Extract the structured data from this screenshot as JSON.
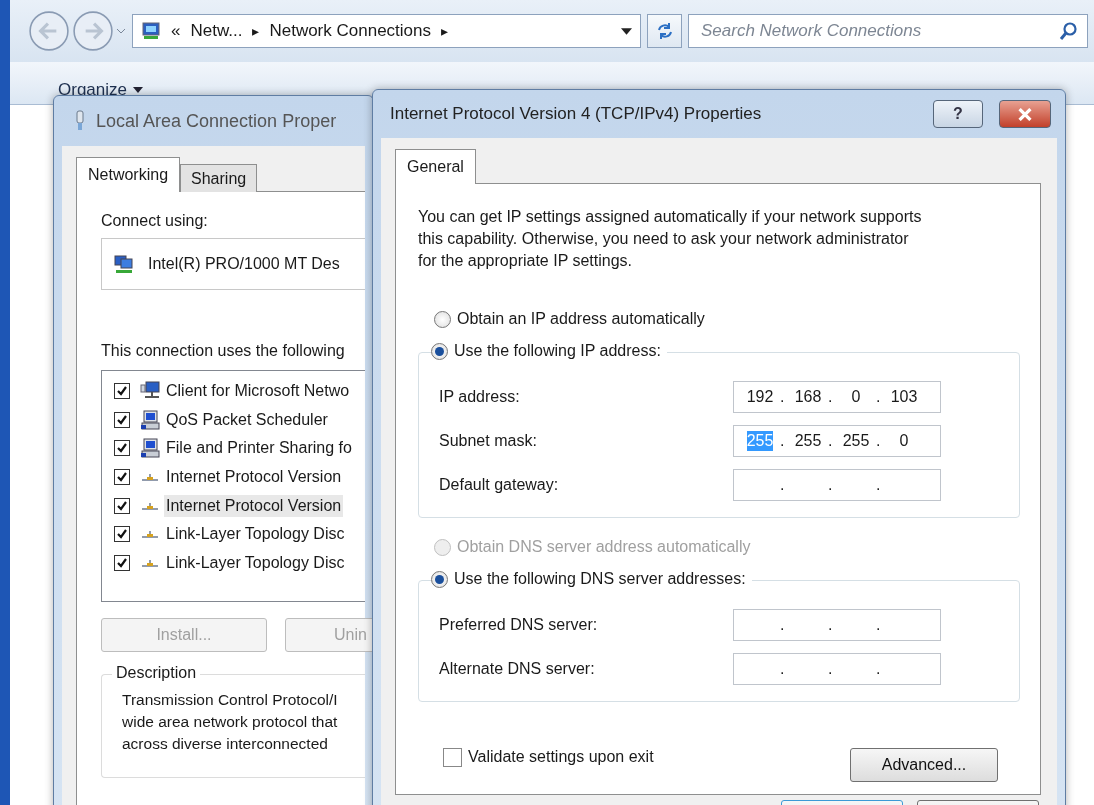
{
  "address_bar": {
    "parts": [
      {
        "kind": "overflow",
        "text": "«"
      },
      {
        "kind": "crumb",
        "text": "Netw..."
      },
      {
        "kind": "arrow",
        "text": "▸"
      },
      {
        "kind": "crumb",
        "text": "Network Connections"
      },
      {
        "kind": "arrow",
        "text": "▸"
      }
    ]
  },
  "search": {
    "placeholder": "Search Network Connections"
  },
  "toolbar": {
    "organize": "Organize"
  },
  "lan_dialog": {
    "title": "Local Area Connection Proper",
    "tabs": [
      {
        "label": "Networking",
        "selected": true
      },
      {
        "label": "Sharing",
        "selected": false
      }
    ],
    "connect_using_label": "Connect using:",
    "adapter": "Intel(R) PRO/1000 MT Des",
    "components_label": "This connection uses the following",
    "components": [
      {
        "name": "Client for Microsoft Netwo",
        "kind": "client",
        "checked": true,
        "selected": false
      },
      {
        "name": "QoS Packet Scheduler",
        "kind": "service",
        "checked": true,
        "selected": false
      },
      {
        "name": "File and Printer Sharing fo",
        "kind": "service",
        "checked": true,
        "selected": false
      },
      {
        "name": "Internet Protocol Version",
        "kind": "protocol",
        "checked": true,
        "selected": false
      },
      {
        "name": "Internet Protocol Version",
        "kind": "protocol",
        "checked": true,
        "selected": true
      },
      {
        "name": "Link-Layer Topology Disc",
        "kind": "protocol",
        "checked": true,
        "selected": false
      },
      {
        "name": "Link-Layer Topology Disc",
        "kind": "protocol",
        "checked": true,
        "selected": false
      }
    ],
    "buttons": [
      {
        "label": "Install...",
        "disabled": true
      },
      {
        "label": "Unin",
        "disabled": true
      }
    ],
    "description": {
      "title": "Description",
      "lines": [
        "Transmission Control Protocol/I",
        "wide area network protocol that",
        "across diverse interconnected"
      ]
    }
  },
  "ipv4_dialog": {
    "title": "Internet Protocol Version 4 (TCP/IPv4) Properties",
    "help": "?",
    "tabs": [
      {
        "label": "General",
        "selected": true
      }
    ],
    "intro_lines": [
      "You can get IP settings assigned automatically if your network supports",
      "this capability. Otherwise, you need to ask your network administrator",
      "for the appropriate IP settings."
    ],
    "ip_auto": {
      "label": "Obtain an IP address automatically",
      "selected": false,
      "disabled": false
    },
    "ip_manual": {
      "label": "Use the following IP address:",
      "selected": true,
      "disabled": false
    },
    "ip_fields": [
      {
        "label": "IP address:",
        "separator": ".",
        "octets": [
          {
            "text": "192",
            "selected": false
          },
          {
            "text": "168",
            "selected": false
          },
          {
            "text": "0",
            "selected": false
          },
          {
            "text": "103",
            "selected": false
          }
        ]
      },
      {
        "label": "Subnet mask:",
        "separator": ".",
        "octets": [
          {
            "text": "255",
            "selected": true
          },
          {
            "text": "255",
            "selected": false
          },
          {
            "text": "255",
            "selected": false
          },
          {
            "text": "0",
            "selected": false
          }
        ]
      },
      {
        "label": "Default gateway:",
        "separator": "."
      }
    ],
    "dns_auto": {
      "label": "Obtain DNS server address automatically",
      "selected": false,
      "disabled": true
    },
    "dns_manual": {
      "label": "Use the following DNS server addresses:",
      "selected": true,
      "disabled": false
    },
    "dns_fields": [
      {
        "label": "Preferred DNS server:",
        "separator": "."
      },
      {
        "label": "Alternate DNS server:",
        "separator": "."
      }
    ],
    "validate": {
      "label": "Validate settings upon exit",
      "checked": false
    },
    "advanced": "Advanced..."
  }
}
